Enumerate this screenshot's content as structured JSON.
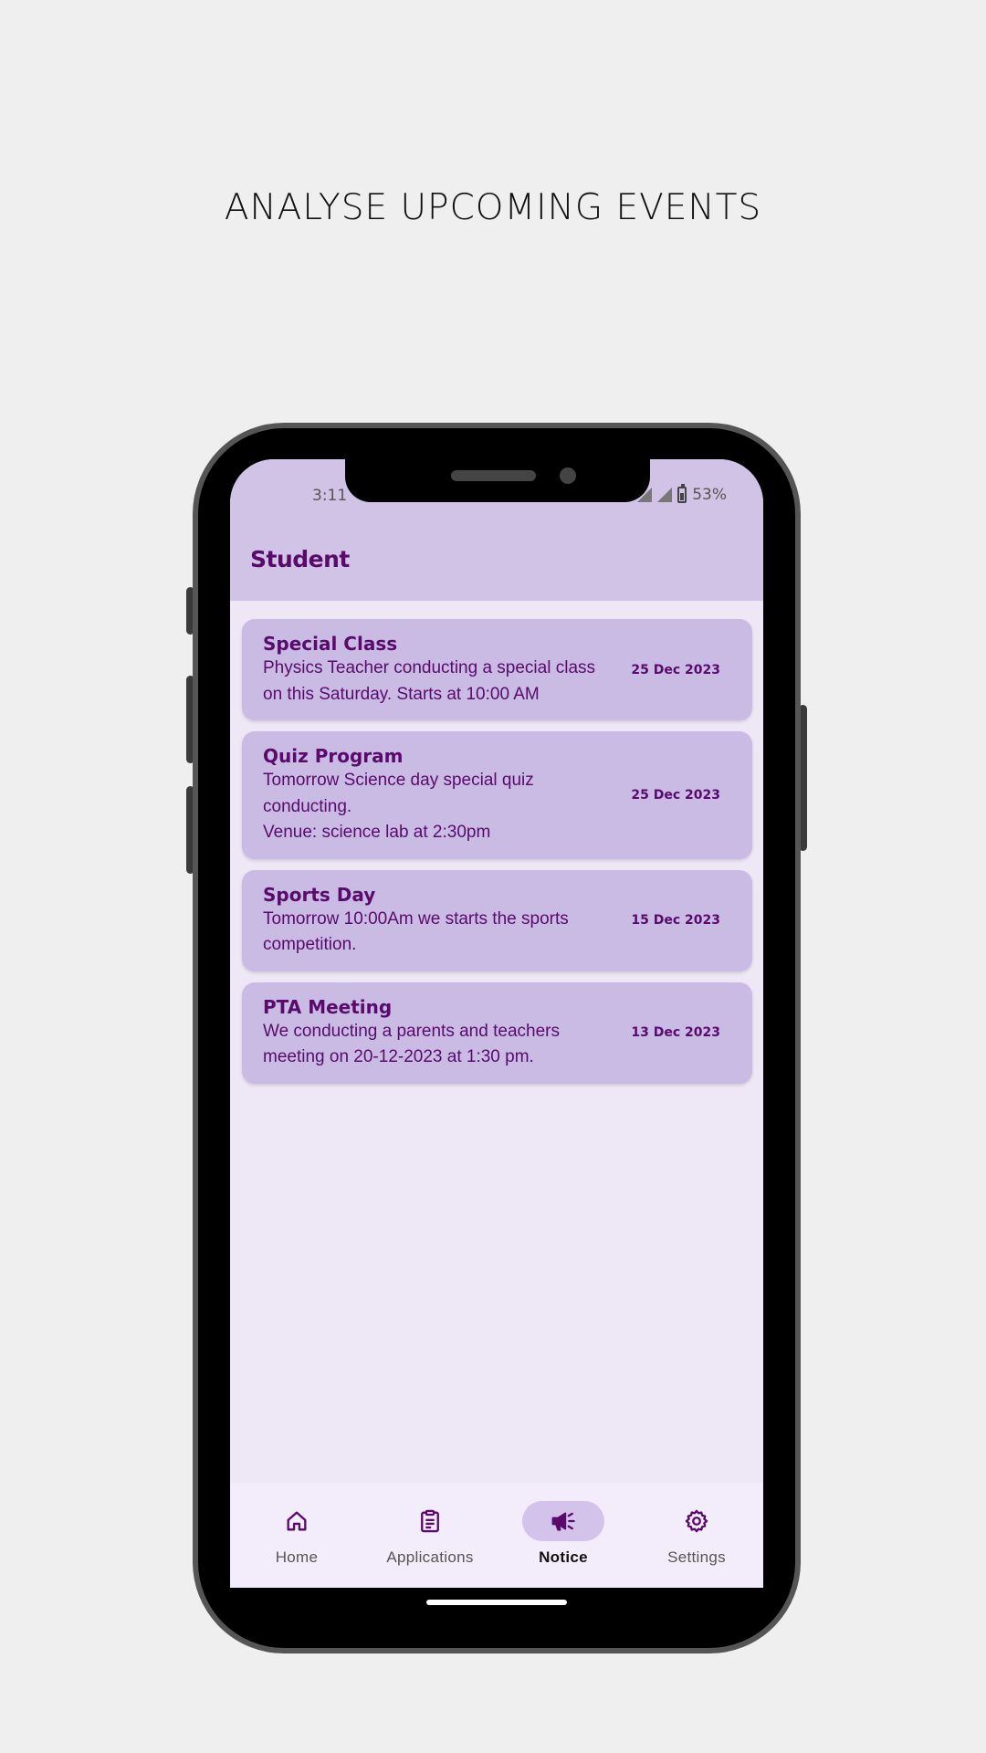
{
  "headline": "ANALYSE UPCOMING EVENTS",
  "status_bar": {
    "time": "3:11",
    "battery": "53%"
  },
  "app_bar": {
    "title": "Student"
  },
  "notices": [
    {
      "title": "Special Class",
      "body": "Physics Teacher conducting a special class on this Saturday. Starts at 10:00 AM",
      "date": "25 Dec 2023"
    },
    {
      "title": "Quiz Program",
      "body": "Tomorrow Science day special quiz conducting.\nVenue: science lab at 2:30pm",
      "date": "25 Dec 2023"
    },
    {
      "title": "Sports Day",
      "body": "Tomorrow 10:00Am we starts the sports competition.",
      "date": "15 Dec 2023"
    },
    {
      "title": "PTA Meeting",
      "body": "We conducting a parents and teachers meeting on 20-12-2023 at 1:30 pm.",
      "date": "13 Dec 2023"
    }
  ],
  "bottom_nav": {
    "items": [
      {
        "label": "Home",
        "icon": "home-icon"
      },
      {
        "label": "Applications",
        "icon": "clipboard-icon"
      },
      {
        "label": "Notice",
        "icon": "megaphone-icon"
      },
      {
        "label": "Settings",
        "icon": "gear-icon"
      }
    ],
    "active": "Notice"
  },
  "colors": {
    "accent": "#5a0a6b",
    "card": "#c9bbe4",
    "appbar": "#d1c3e6",
    "background": "#ede7f6",
    "nav_pill": "#d3c3ea"
  }
}
